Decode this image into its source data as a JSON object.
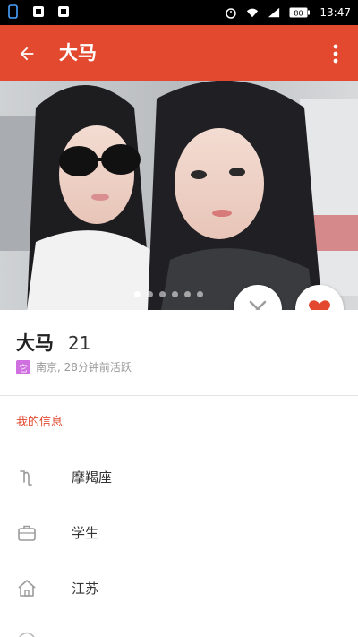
{
  "status_bar": {
    "time": "13:47",
    "battery_level": "80",
    "icons": [
      "sim-icon",
      "notification-icon-1",
      "notification-icon-2",
      "alarm-icon",
      "wifi-icon",
      "signal-icon",
      "battery-icon"
    ]
  },
  "toolbar": {
    "title": "大马",
    "back_icon": "arrow-back-icon",
    "more_icon": "more-vert-icon",
    "background": "#e2492f"
  },
  "photo": {
    "pager_count": 6,
    "pager_active_index": 0
  },
  "actions": {
    "pass_icon": "close-icon",
    "like_icon": "heart-icon",
    "like_color": "#e2492f"
  },
  "profile": {
    "name": "大马",
    "age": "21",
    "location_badge": "它",
    "location_text": "南京, 28分钟前活跃"
  },
  "info": {
    "section_title": "我的信息",
    "rows": [
      {
        "icon": "zodiac-icon",
        "label": "摩羯座"
      },
      {
        "icon": "briefcase-icon",
        "label": "学生"
      },
      {
        "icon": "home-icon",
        "label": "江苏"
      }
    ]
  },
  "colors": {
    "accent": "#e2492f",
    "location_badge": "#cf6fe0"
  }
}
